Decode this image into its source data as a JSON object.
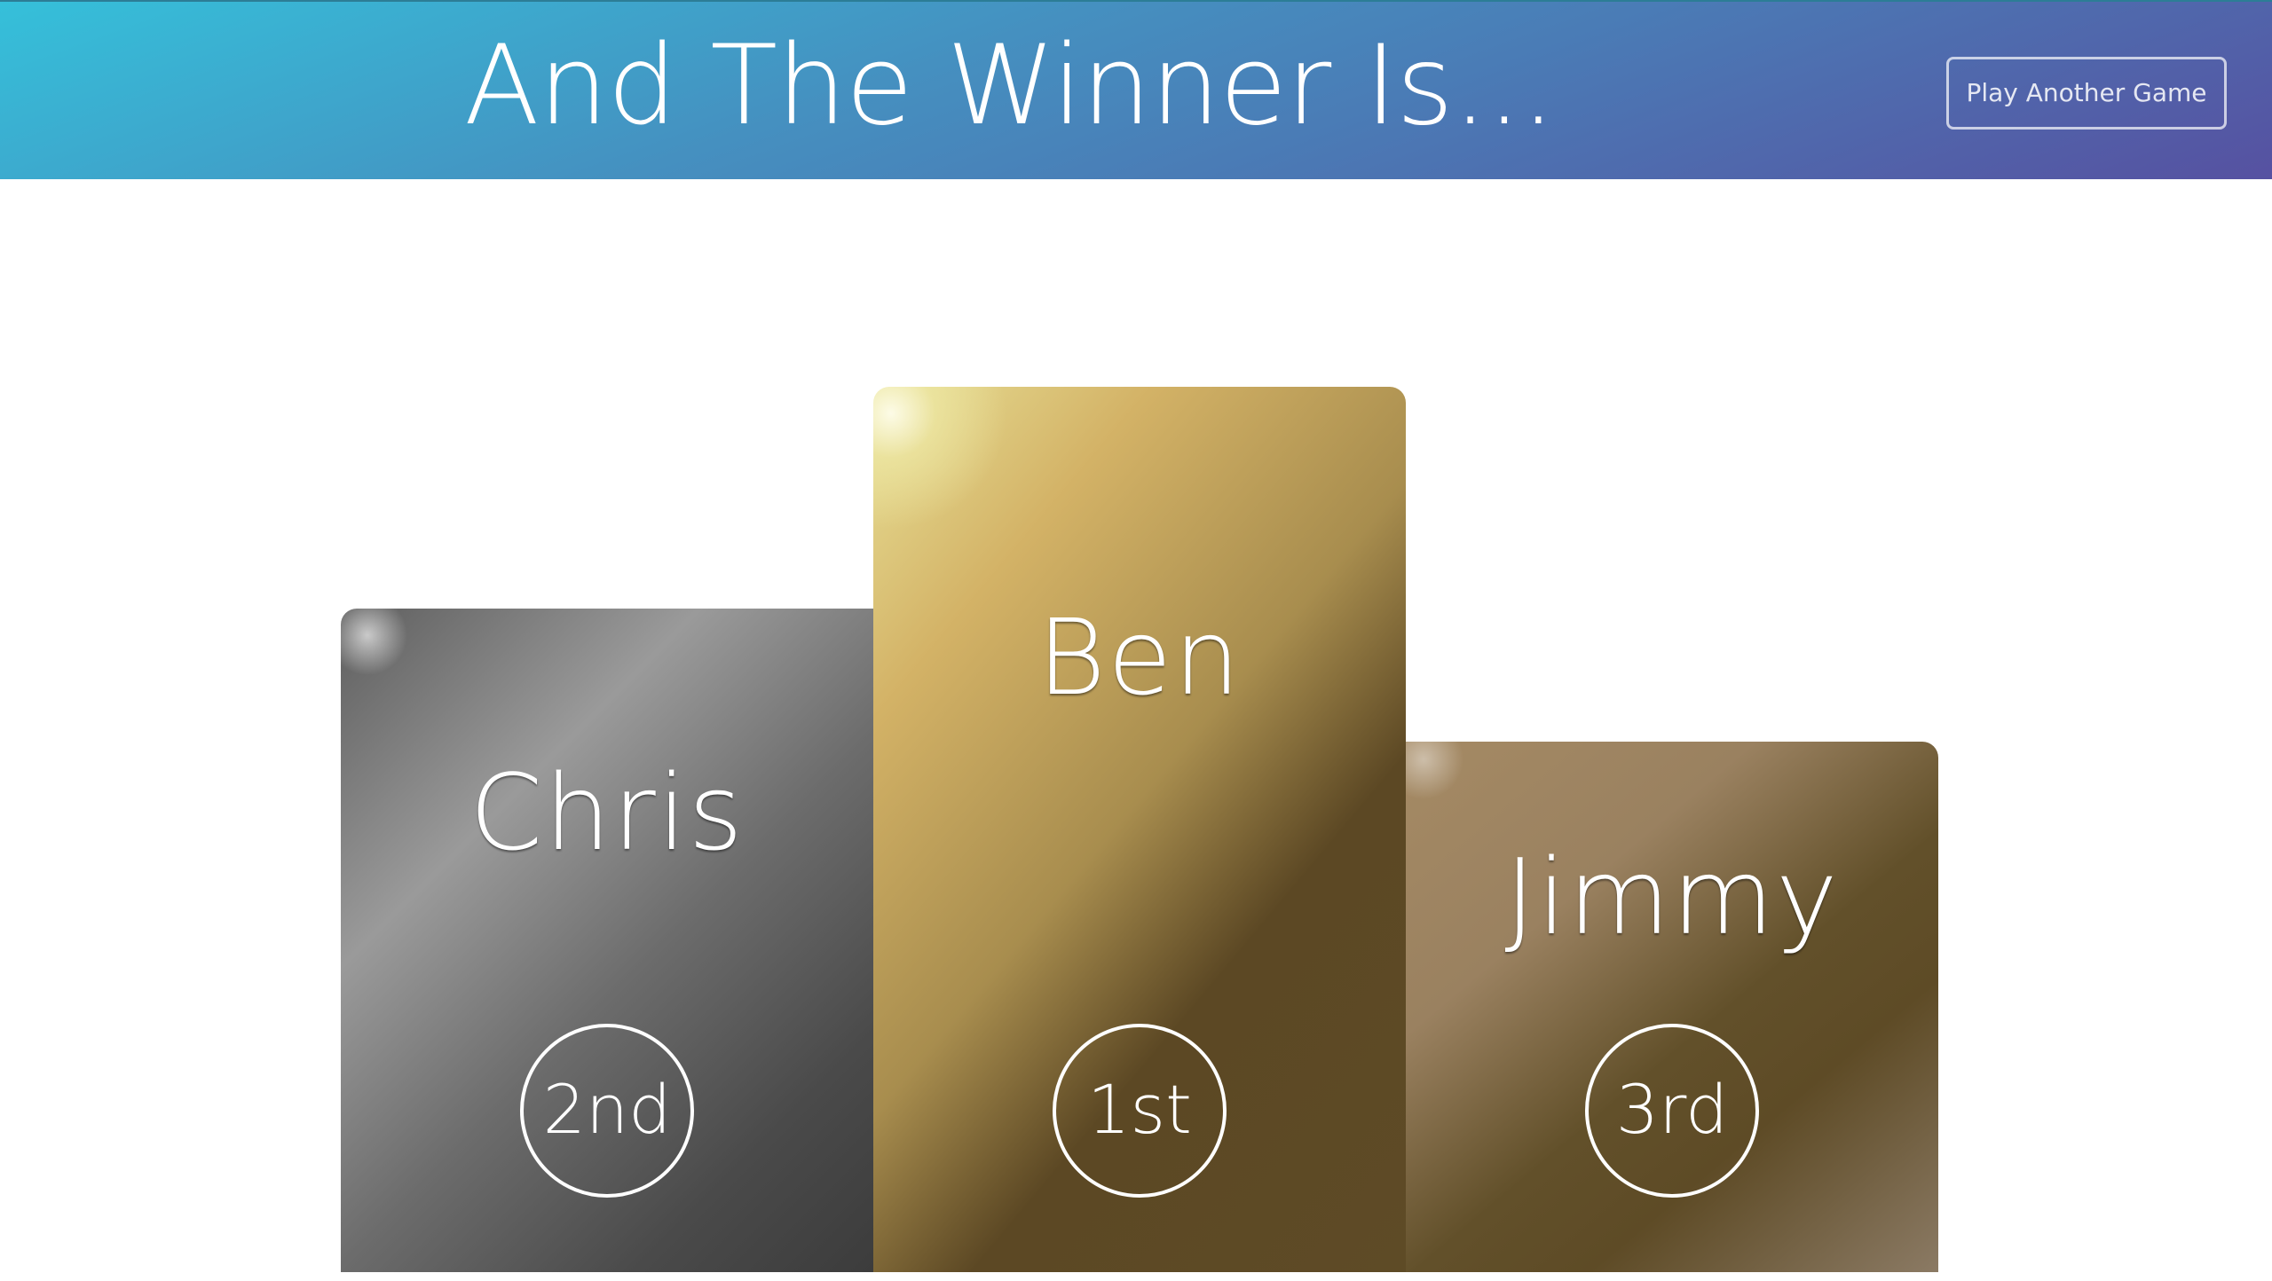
{
  "header": {
    "title": "And The Winner Is...",
    "play_again_label": "Play Another Game"
  },
  "podium": [
    {
      "name": "Chris",
      "rank": "2nd",
      "medal": "silver"
    },
    {
      "name": "Ben",
      "rank": "1st",
      "medal": "gold"
    },
    {
      "name": "Jimmy",
      "rank": "3rd",
      "medal": "bronze"
    }
  ],
  "colors": {
    "header_gradient_start": "#35c0da",
    "header_gradient_end": "#5651a1",
    "silver": "#7a7a7a",
    "gold": "#c9a85c",
    "bronze": "#8a7050",
    "text": "#ffffff"
  }
}
